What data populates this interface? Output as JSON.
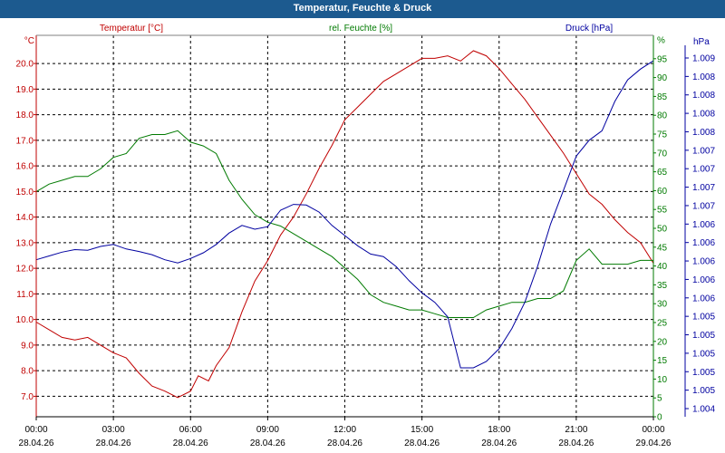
{
  "window": {
    "title": "Temperatur, Feuchte & Druck"
  },
  "colors": {
    "titlebar": "#1c5a8f",
    "temperature": "#c00000",
    "humidity": "#007a00",
    "pressure": "#0000a0",
    "grid": "#000000"
  },
  "chart_data": {
    "type": "line",
    "title": "Temperatur, Feuchte & Druck",
    "grid": true,
    "x": {
      "tick_times": [
        "00:00",
        "03:00",
        "06:00",
        "09:00",
        "12:00",
        "15:00",
        "18:00",
        "21:00",
        "00:00"
      ],
      "tick_dates": [
        "28.04.26",
        "28.04.26",
        "28.04.26",
        "28.04.26",
        "28.04.26",
        "28.04.26",
        "28.04.26",
        "28.04.26",
        "29.04.26"
      ],
      "range_hours": [
        0,
        24
      ]
    },
    "axes": {
      "temperature": {
        "label": "Temperatur [°C]",
        "unit": "°C",
        "range": [
          6.2,
          21.1
        ],
        "ticks": [
          "7.0",
          "8.0",
          "9.0",
          "10.0",
          "11.0",
          "12.0",
          "13.0",
          "14.0",
          "15.0",
          "16.0",
          "17.0",
          "18.0",
          "19.0",
          "20.0"
        ]
      },
      "humidity": {
        "label": "rel. Feuchte [%]",
        "unit": "%",
        "range": [
          0,
          100
        ],
        "ticks": [
          "0",
          "5",
          "10",
          "15",
          "20",
          "25",
          "30",
          "35",
          "40",
          "45",
          "50",
          "55",
          "60",
          "65",
          "70",
          "75",
          "80",
          "85",
          "90",
          "95",
          "%"
        ]
      },
      "pressure": {
        "label": "Druck [hPa]",
        "unit": "hPa",
        "range": [
          1003.5,
          1009.5
        ],
        "ticks": [
          "1.004",
          "1.005",
          "1.005",
          "1.005",
          "1.005",
          "1.005",
          "1.006",
          "1.006",
          "1.006",
          "1.006",
          "1.006",
          "1.007",
          "1.007",
          "1.007",
          "1.007",
          "1.008",
          "1.008",
          "1.008",
          "1.008",
          "1.009"
        ]
      }
    },
    "series": [
      {
        "name": "Temperatur [°C]",
        "axis": "temperature",
        "color": "#c00000",
        "points": [
          [
            0,
            9.9
          ],
          [
            0.5,
            9.6
          ],
          [
            1,
            9.3
          ],
          [
            1.5,
            9.2
          ],
          [
            2,
            9.3
          ],
          [
            2.5,
            9.0
          ],
          [
            3,
            8.7
          ],
          [
            3.5,
            8.5
          ],
          [
            4,
            7.9
          ],
          [
            4.5,
            7.4
          ],
          [
            5,
            7.2
          ],
          [
            5.5,
            6.95
          ],
          [
            6,
            7.2
          ],
          [
            6.3,
            7.8
          ],
          [
            6.7,
            7.6
          ],
          [
            7,
            8.2
          ],
          [
            7.5,
            8.9
          ],
          [
            8,
            10.3
          ],
          [
            8.5,
            11.5
          ],
          [
            9,
            12.3
          ],
          [
            9.5,
            13.3
          ],
          [
            10,
            14.0
          ],
          [
            10.5,
            14.9
          ],
          [
            11,
            15.9
          ],
          [
            11.5,
            16.8
          ],
          [
            12,
            17.8
          ],
          [
            12.5,
            18.3
          ],
          [
            13,
            18.8
          ],
          [
            13.5,
            19.3
          ],
          [
            14,
            19.6
          ],
          [
            14.5,
            19.9
          ],
          [
            15,
            20.2
          ],
          [
            15.5,
            20.2
          ],
          [
            16,
            20.3
          ],
          [
            16.5,
            20.1
          ],
          [
            17,
            20.5
          ],
          [
            17.5,
            20.3
          ],
          [
            18,
            19.8
          ],
          [
            18.5,
            19.2
          ],
          [
            19,
            18.6
          ],
          [
            19.5,
            17.9
          ],
          [
            20,
            17.2
          ],
          [
            20.5,
            16.5
          ],
          [
            21,
            15.7
          ],
          [
            21.5,
            14.9
          ],
          [
            22,
            14.5
          ],
          [
            22.5,
            13.9
          ],
          [
            23,
            13.4
          ],
          [
            23.5,
            13.0
          ],
          [
            24,
            12.2
          ]
        ]
      },
      {
        "name": "rel. Feuchte [%]",
        "axis": "humidity",
        "color": "#007a00",
        "points": [
          [
            0,
            59
          ],
          [
            0.5,
            61
          ],
          [
            1,
            62
          ],
          [
            1.5,
            63
          ],
          [
            2,
            63
          ],
          [
            2.5,
            65
          ],
          [
            3,
            68
          ],
          [
            3.5,
            69
          ],
          [
            4,
            73
          ],
          [
            4.5,
            74
          ],
          [
            5,
            74
          ],
          [
            5.5,
            75
          ],
          [
            6,
            72
          ],
          [
            6.5,
            71
          ],
          [
            7,
            69
          ],
          [
            7.5,
            62
          ],
          [
            8,
            57
          ],
          [
            8.5,
            53
          ],
          [
            9,
            51
          ],
          [
            9.5,
            50
          ],
          [
            10,
            48
          ],
          [
            10.5,
            46
          ],
          [
            11,
            44
          ],
          [
            11.5,
            42
          ],
          [
            12,
            39
          ],
          [
            12.5,
            36
          ],
          [
            13,
            32
          ],
          [
            13.5,
            30
          ],
          [
            14,
            29
          ],
          [
            14.5,
            28
          ],
          [
            15,
            28
          ],
          [
            15.5,
            27
          ],
          [
            16,
            26
          ],
          [
            16.5,
            26
          ],
          [
            17,
            26
          ],
          [
            17.5,
            28
          ],
          [
            18,
            29
          ],
          [
            18.5,
            30
          ],
          [
            19,
            30
          ],
          [
            19.5,
            31
          ],
          [
            20,
            31
          ],
          [
            20.5,
            33
          ],
          [
            21,
            41
          ],
          [
            21.5,
            44
          ],
          [
            22,
            40
          ],
          [
            22.5,
            40
          ],
          [
            23,
            40
          ],
          [
            23.5,
            41
          ],
          [
            24,
            41
          ]
        ]
      },
      {
        "name": "Druck [hPa]",
        "axis": "pressure",
        "color": "#0000a0",
        "points": [
          [
            0,
            1005.97
          ],
          [
            0.5,
            1006.03
          ],
          [
            1,
            1006.09
          ],
          [
            1.5,
            1006.13
          ],
          [
            2,
            1006.12
          ],
          [
            2.5,
            1006.18
          ],
          [
            3,
            1006.21
          ],
          [
            3.5,
            1006.14
          ],
          [
            4,
            1006.1
          ],
          [
            4.5,
            1006.05
          ],
          [
            5,
            1005.97
          ],
          [
            5.5,
            1005.92
          ],
          [
            6,
            1005.99
          ],
          [
            6.5,
            1006.08
          ],
          [
            7,
            1006.21
          ],
          [
            7.5,
            1006.39
          ],
          [
            8,
            1006.51
          ],
          [
            8.5,
            1006.45
          ],
          [
            9,
            1006.49
          ],
          [
            9.5,
            1006.75
          ],
          [
            10,
            1006.84
          ],
          [
            10.5,
            1006.83
          ],
          [
            11,
            1006.72
          ],
          [
            11.5,
            1006.51
          ],
          [
            12,
            1006.35
          ],
          [
            12.5,
            1006.19
          ],
          [
            13,
            1006.06
          ],
          [
            13.5,
            1006.02
          ],
          [
            14,
            1005.86
          ],
          [
            14.5,
            1005.64
          ],
          [
            15,
            1005.45
          ],
          [
            15.5,
            1005.3
          ],
          [
            16,
            1005.07
          ],
          [
            16.5,
            1004.27
          ],
          [
            17,
            1004.27
          ],
          [
            17.5,
            1004.37
          ],
          [
            18,
            1004.57
          ],
          [
            18.5,
            1004.89
          ],
          [
            19,
            1005.3
          ],
          [
            19.5,
            1005.87
          ],
          [
            20,
            1006.53
          ],
          [
            20.5,
            1007.06
          ],
          [
            21,
            1007.6
          ],
          [
            21.5,
            1007.85
          ],
          [
            22,
            1008.0
          ],
          [
            22.5,
            1008.46
          ],
          [
            23,
            1008.8
          ],
          [
            23.5,
            1008.97
          ],
          [
            24,
            1009.1
          ]
        ]
      }
    ]
  }
}
